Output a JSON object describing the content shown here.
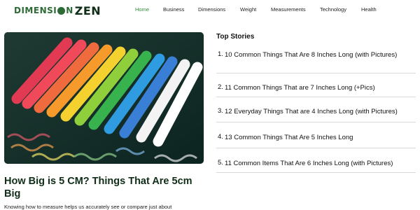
{
  "header": {
    "logo": {
      "part1": "DIMENSI",
      "part2": "N",
      "part3": "ZEN"
    },
    "nav": [
      {
        "label": "Home",
        "active": true
      },
      {
        "label": "Business"
      },
      {
        "label": "Dimensions"
      },
      {
        "label": "Weight"
      },
      {
        "label": "Measurements"
      },
      {
        "label": "Technology"
      },
      {
        "label": "Health"
      }
    ]
  },
  "colors": {
    "accent": "#2f8f3a",
    "logo_dark": "#0f2d17",
    "board": "#0f2b24"
  },
  "main": {
    "title": "How Big is 5 CM? Things That Are 5cm Big",
    "excerpt": "Knowing how to measure helps us accurately see or compare just about"
  },
  "sidebar": {
    "title": "Top Stories",
    "stories": [
      {
        "num": "1.",
        "text": "10 Common Things That Are 8 Inches Long (with Pictures)"
      },
      {
        "num": "2.",
        "text": "11 Common Things That are 7 Inches Long (+Pics)"
      },
      {
        "num": "3.",
        "text": "12 Everyday Things That are 4 Inches Long (with Pictures)"
      },
      {
        "num": "4.",
        "text": "13 Common Things That Are 5 Inches Long"
      },
      {
        "num": "5.",
        "text": "11 Common Items That Are 6 Inches Long (with Pictures)"
      }
    ]
  }
}
